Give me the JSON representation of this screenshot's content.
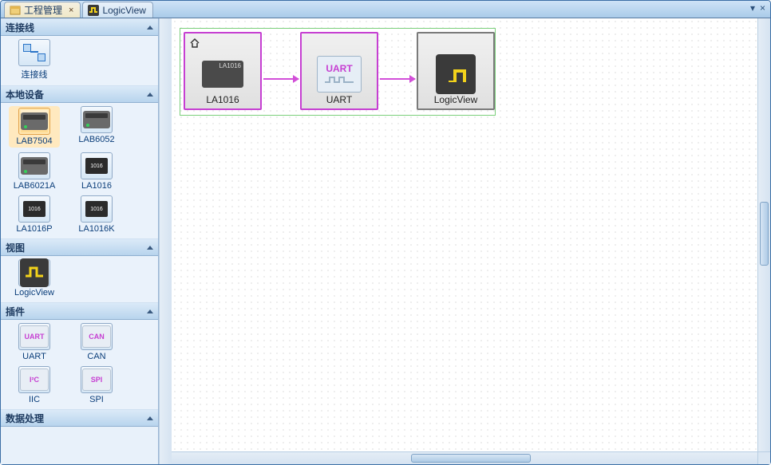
{
  "tabs": [
    {
      "label": "工程管理",
      "icon": "project-icon",
      "closable": true,
      "active": true
    },
    {
      "label": "LogicView",
      "icon": "logicview-icon",
      "closable": false,
      "active": false
    }
  ],
  "sidebar": {
    "sections": [
      {
        "title": "连接线",
        "id": "connector",
        "items": [
          {
            "label": "连接线",
            "icon": "connector-icon",
            "selected": false
          }
        ]
      },
      {
        "title": "本地设备",
        "id": "devices",
        "items": [
          {
            "label": "LAB7504",
            "icon": "device-card-icon",
            "selected": true
          },
          {
            "label": "LAB6052",
            "icon": "device-card-icon",
            "selected": false
          },
          {
            "label": "LAB6021A",
            "icon": "device-card-icon",
            "selected": false
          },
          {
            "label": "LA1016",
            "icon": "chip-icon",
            "selected": false
          },
          {
            "label": "LA1016P",
            "icon": "chip-icon",
            "selected": false
          },
          {
            "label": "LA1016K",
            "icon": "chip-icon",
            "selected": false
          }
        ]
      },
      {
        "title": "视图",
        "id": "views",
        "items": [
          {
            "label": "LogicView",
            "icon": "logicview-icon",
            "selected": false
          }
        ]
      },
      {
        "title": "插件",
        "id": "plugins",
        "items": [
          {
            "label": "UART",
            "icon": "uart-icon",
            "selected": false
          },
          {
            "label": "CAN",
            "icon": "can-icon",
            "selected": false
          },
          {
            "label": "IIC",
            "icon": "iic-icon",
            "selected": false
          },
          {
            "label": "SPI",
            "icon": "spi-icon",
            "selected": false
          }
        ]
      },
      {
        "title": "数据处理",
        "id": "dataproc",
        "items": []
      }
    ]
  },
  "canvas": {
    "nodes": [
      {
        "label": "LA1016",
        "icon": "device-chip-icon",
        "has_home": true
      },
      {
        "label": "UART",
        "icon": "uart-block-icon",
        "has_home": false
      },
      {
        "label": "LogicView",
        "icon": "logicview-block-icon",
        "has_home": false
      }
    ]
  },
  "iconText": {
    "uart": "UART",
    "can": "CAN",
    "iic": "I²C",
    "spi": "SPI",
    "chip1016": "1016",
    "la1016": "LA1016"
  }
}
